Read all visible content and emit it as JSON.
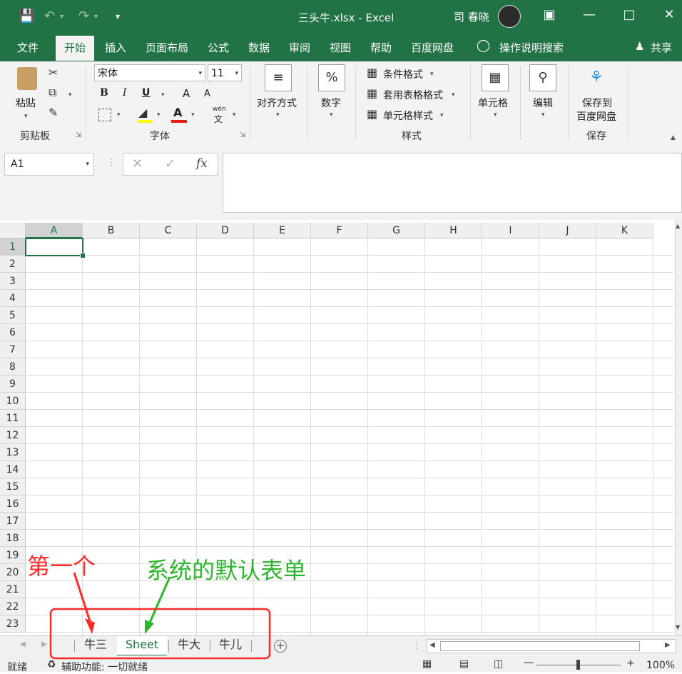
{
  "titlebar": {
    "filename": "三头牛.xlsx",
    "separator": "-",
    "app": "Excel",
    "user": "司 春晓"
  },
  "tabs": {
    "file": "文件",
    "home": "开始",
    "insert": "插入",
    "layout": "页面布局",
    "formulas": "公式",
    "data": "数据",
    "review": "审阅",
    "view": "视图",
    "help": "帮助",
    "baidu": "百度网盘",
    "tellme": "操作说明搜索",
    "share": "共享"
  },
  "ribbon": {
    "clipboard": {
      "paste": "粘贴",
      "label": "剪贴板"
    },
    "font": {
      "name": "宋体",
      "size": "11",
      "bold": "B",
      "italic": "I",
      "underline": "U",
      "grow": "A",
      "shrink": "A",
      "color_letter": "A",
      "phonetic_top": "wén",
      "phonetic_bottom": "文",
      "label": "字体"
    },
    "alignment": {
      "label": "对齐方式"
    },
    "number": {
      "label": "数字",
      "symbol": "%"
    },
    "styles": {
      "conditional": "条件格式",
      "table": "套用表格格式",
      "cell": "单元格样式",
      "label": "样式"
    },
    "cells": {
      "label": "单元格"
    },
    "editing": {
      "label": "编辑"
    },
    "save": {
      "line1": "保存到",
      "line2": "百度网盘",
      "label": "保存"
    }
  },
  "formula_bar": {
    "name_box": "A1",
    "fx": "fx",
    "cancel": "✕",
    "enter": "✓"
  },
  "columns": [
    "A",
    "B",
    "C",
    "D",
    "E",
    "F",
    "G",
    "H",
    "I",
    "J",
    "K"
  ],
  "rows": [
    "1",
    "2",
    "3",
    "4",
    "5",
    "6",
    "7",
    "8",
    "9",
    "10",
    "11",
    "12",
    "13",
    "14",
    "15",
    "16",
    "17",
    "18",
    "19",
    "20",
    "21",
    "22",
    "23"
  ],
  "sheets": [
    "牛三",
    "Sheet",
    "牛大",
    "牛儿"
  ],
  "status": {
    "ready": "就绪",
    "accessibility": "辅助功能: 一切就绪",
    "zoom": "100%"
  },
  "annotations": {
    "first": "第一个",
    "default_sheet": "系统的默认表单"
  },
  "colors": {
    "excel_green": "#217346",
    "annotation_red": "#ff2a2a",
    "annotation_green": "#2db52d"
  }
}
